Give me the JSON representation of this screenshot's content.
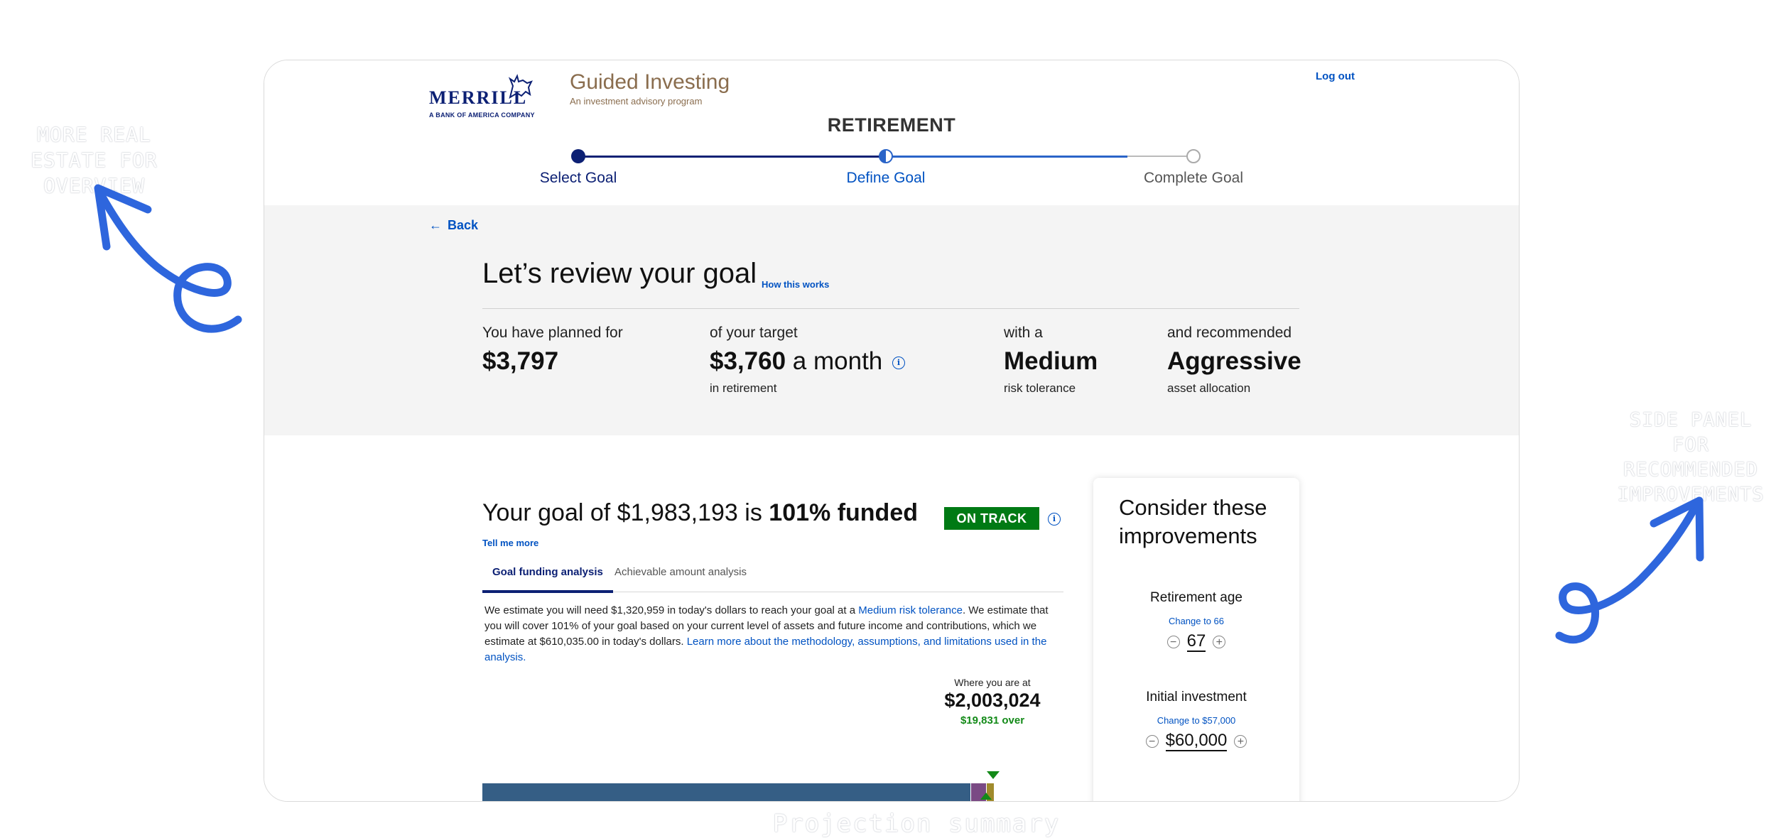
{
  "annotations": {
    "left": "MORE REAL ESTATE FOR OVERVIEW",
    "right": "SIDE PANEL FOR RECOMMENDED IMPROVEMENTS",
    "bottom": "Projection summary"
  },
  "header": {
    "logo_word": "MERRILL",
    "logo_sub": "A BANK OF AMERICA COMPANY",
    "product_title": "Guided Investing",
    "product_sub": "An investment advisory program",
    "logout_label": "Log out",
    "section_title": "RETIREMENT"
  },
  "steps": [
    {
      "label": "Select Goal",
      "state": "done"
    },
    {
      "label": "Define Goal",
      "state": "current"
    },
    {
      "label": "Complete Goal",
      "state": "upcoming"
    }
  ],
  "summary": {
    "back_label": "Back",
    "title": "Let’s review your goal",
    "how_link": "How this works",
    "planned_label": "You have planned for",
    "planned_value": "$3,797",
    "target_label": "of your target",
    "target_value": "$3,760",
    "target_unit": "a month",
    "target_foot": "in retirement",
    "risk_label": "with a",
    "risk_value": "Medium",
    "risk_foot": "risk tolerance",
    "alloc_label": "and recommended",
    "alloc_value": "Aggressive",
    "alloc_foot": "asset allocation"
  },
  "goal": {
    "title_prefix": "Your goal of $1,983,193 is",
    "title_strong": "101% funded",
    "status_badge": "ON TRACK",
    "tell_more": "Tell me more",
    "tabs": [
      {
        "label": "Goal funding analysis",
        "active": true
      },
      {
        "label": "Achievable amount analysis",
        "active": false
      }
    ],
    "text_1": "We estimate you will need $1,320,959 in today's dollars to reach your goal at a ",
    "text_link_1": "Medium risk tolerance",
    "text_2": ". We estimate that you will cover 101% of your goal based on your current level of assets and future income and contributions, which we estimate at $610,035.00 in today's dollars. ",
    "text_link_2": "Learn more about the methodology, assumptions, and limitations used in the analysis."
  },
  "projection": {
    "where_label": "Where you are at",
    "where_amount": "$2,003,024",
    "over_label": "$19,831 over",
    "segments": [
      {
        "fraction": 0.956,
        "color": "#355e85"
      },
      {
        "fraction": 0.03,
        "color": "#7a4a84"
      },
      {
        "fraction": 0.014,
        "color": "#a08b2c"
      }
    ]
  },
  "improvements": {
    "title": "Consider these improvements",
    "items": [
      {
        "label": "Retirement age",
        "link": "Change to 66",
        "value": "67"
      },
      {
        "label": "Initial investment",
        "link": "Change to $57,000",
        "value": "$60,000"
      }
    ]
  },
  "colors": {
    "brand_navy": "#0c2074",
    "link_blue": "#0052c2",
    "on_track_green": "#007a14",
    "product_brown": "#8a6d4e"
  }
}
